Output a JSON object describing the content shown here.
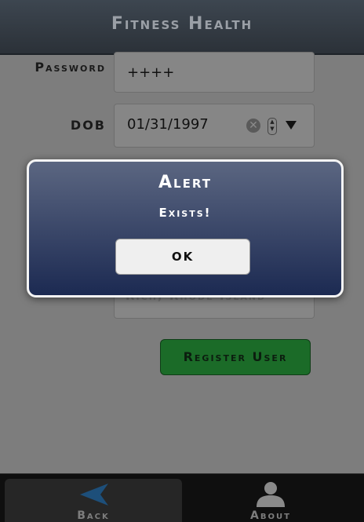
{
  "header": {
    "title": "Fitness Health"
  },
  "form": {
    "password_label": "Password",
    "password_value": "++++",
    "dob_label": "DOB",
    "dob_value": "01/31/1997",
    "partially_visible_value": "Rich, Rhode Island",
    "register_button": "Register User"
  },
  "footer": {
    "back_label": "Back",
    "about_label": "About"
  },
  "alert": {
    "title": "Alert",
    "message": "Exists!",
    "ok_label": "OK"
  },
  "colors": {
    "header_bg": "#2b3138",
    "register_green": "#1b6b28",
    "dialog_top": "#5b6681",
    "dialog_bottom": "#1c2a52",
    "back_arrow": "#1d4f7a"
  }
}
